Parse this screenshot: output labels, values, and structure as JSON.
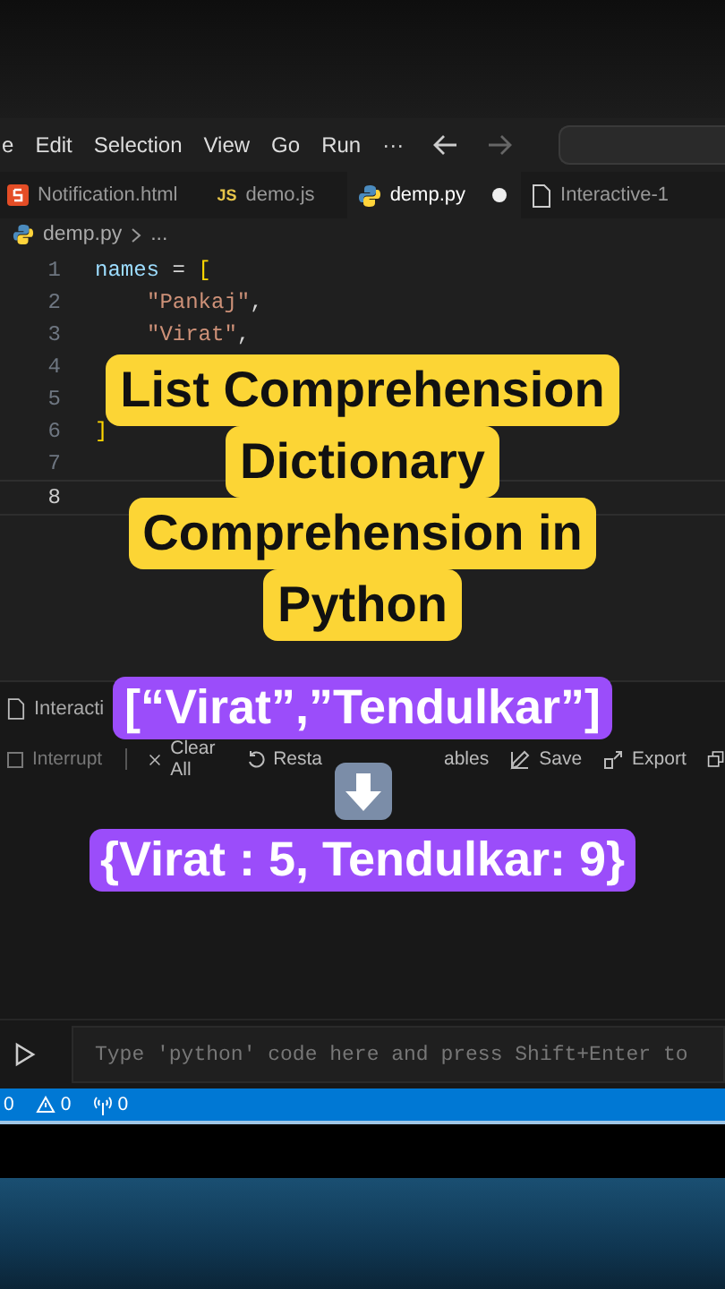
{
  "menu": [
    "e",
    "Edit",
    "Selection",
    "View",
    "Go",
    "Run",
    "···"
  ],
  "editor_tabs": [
    {
      "label": "Notification.html",
      "kind": "html",
      "selected": false,
      "modified": false
    },
    {
      "label": "demo.js",
      "kind": "js",
      "icon_text": "JS",
      "selected": false,
      "modified": false
    },
    {
      "label": "demp.py",
      "kind": "py",
      "selected": true,
      "modified": true
    },
    {
      "label": "Interactive-1",
      "kind": "file",
      "selected": false,
      "modified": false
    }
  ],
  "breadcrumb": {
    "file": "demp.py",
    "rest": "..."
  },
  "code_lines": [
    {
      "number": "1",
      "current": false,
      "tokens": [
        {
          "kind": "var",
          "text": "names"
        },
        {
          "kind": "op",
          "text": " = "
        },
        {
          "kind": "bracket",
          "text": "["
        }
      ]
    },
    {
      "number": "2",
      "current": false,
      "tokens": [
        {
          "kind": "string",
          "text": "\"Pankaj\""
        },
        {
          "kind": "op",
          "text": ","
        }
      ]
    },
    {
      "number": "3",
      "current": false,
      "tokens": [
        {
          "kind": "string",
          "text": "\"Virat\""
        },
        {
          "kind": "op",
          "text": ","
        }
      ]
    },
    {
      "number": "4",
      "current": false
    },
    {
      "number": "5",
      "current": false
    },
    {
      "number": "6",
      "current": false,
      "tokens": [
        {
          "kind": "bracket",
          "text": "]"
        }
      ]
    },
    {
      "number": "7",
      "current": false
    },
    {
      "number": "8",
      "current": true
    }
  ],
  "panel": {
    "tab": "Interacti",
    "toolbar": [
      {
        "kind": "interrupt",
        "label": "Interrupt",
        "disabled": true
      },
      {
        "kind": "clear",
        "label": "Clear All",
        "disabled": false
      },
      {
        "kind": "restart",
        "label": "Resta",
        "disabled": false
      },
      {
        "kind": "partial",
        "label": "ables",
        "disabled": false
      },
      {
        "kind": "save",
        "label": "Save",
        "disabled": false
      },
      {
        "kind": "export",
        "label": "Export",
        "disabled": false
      }
    ],
    "input_placeholder": "Type 'python' code here and press Shift+Enter to"
  },
  "status_bar": [
    {
      "kind": "errors",
      "text": "0"
    },
    {
      "kind": "warnings",
      "text": "0"
    },
    {
      "kind": "ports",
      "text": "0"
    }
  ],
  "captions": {
    "title_lines": [
      "List Comprehension",
      "Dictionary",
      "Comprehension in",
      "Python"
    ],
    "before": "[“Virat”,”Tendulkar”]",
    "after": "{Virat : 5, Tendulkar: 9}"
  }
}
